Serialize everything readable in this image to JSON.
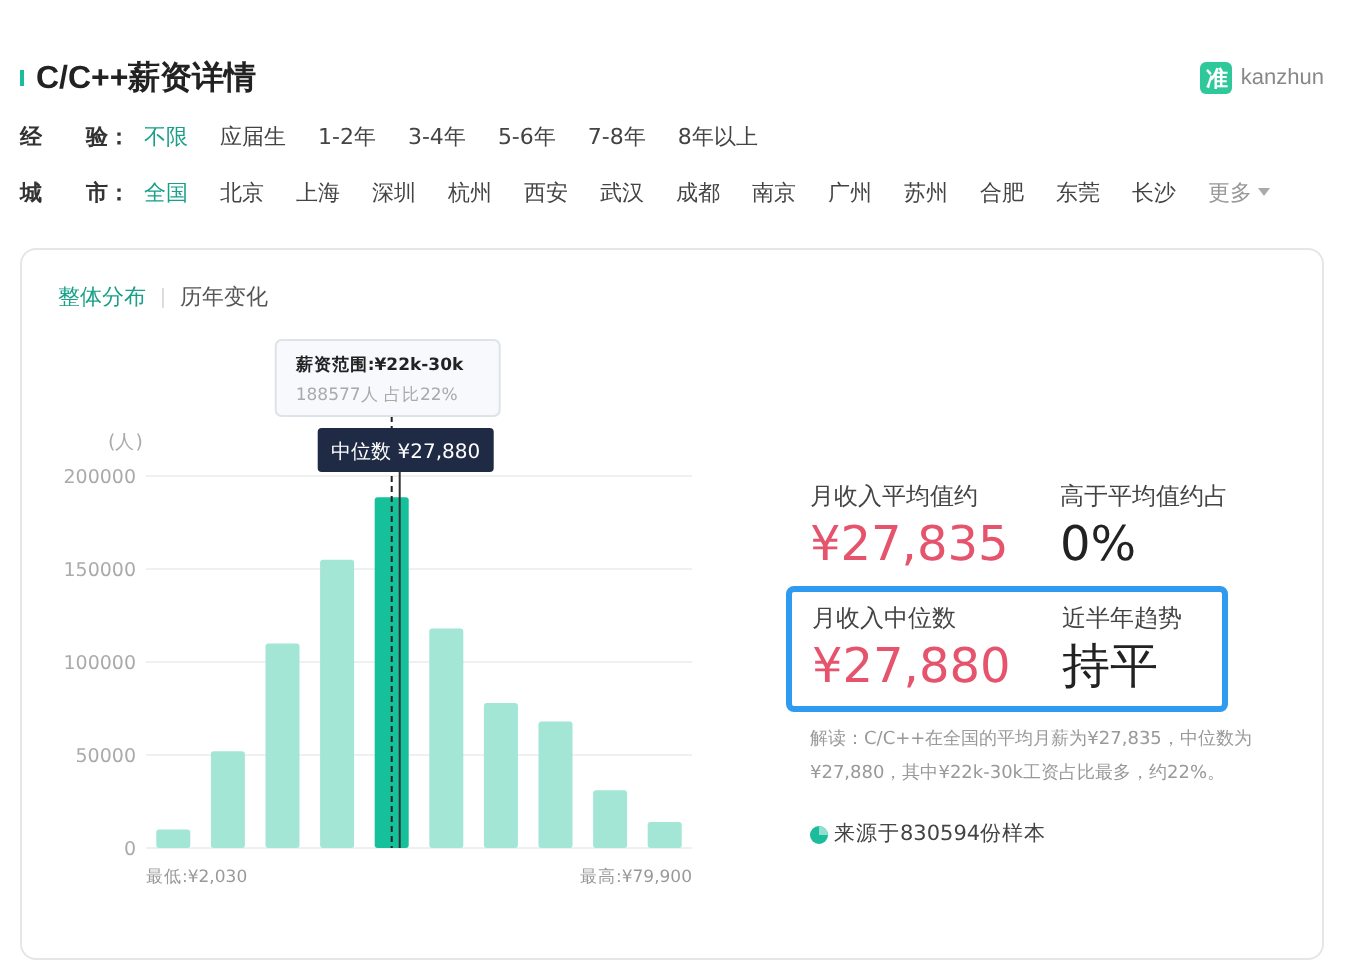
{
  "header": {
    "title": "C/C++薪资详情",
    "logo": {
      "mark": "准",
      "name": "kanzhun"
    }
  },
  "filters": [
    {
      "label": "经　　验：",
      "options": [
        {
          "text": "不限",
          "selected": true
        },
        {
          "text": "应届生",
          "selected": false
        },
        {
          "text": "1-2年",
          "selected": false
        },
        {
          "text": "3-4年",
          "selected": false
        },
        {
          "text": "5-6年",
          "selected": false
        },
        {
          "text": "7-8年",
          "selected": false
        },
        {
          "text": "8年以上",
          "selected": false
        }
      ]
    },
    {
      "label": "城　　市：",
      "options": [
        {
          "text": "全国",
          "selected": true
        },
        {
          "text": "北京",
          "selected": false
        },
        {
          "text": "上海",
          "selected": false
        },
        {
          "text": "深圳",
          "selected": false
        },
        {
          "text": "杭州",
          "selected": false
        },
        {
          "text": "西安",
          "selected": false
        },
        {
          "text": "武汉",
          "selected": false
        },
        {
          "text": "成都",
          "selected": false
        },
        {
          "text": "南京",
          "selected": false
        },
        {
          "text": "广州",
          "selected": false
        },
        {
          "text": "苏州",
          "selected": false
        },
        {
          "text": "合肥",
          "selected": false
        },
        {
          "text": "东莞",
          "selected": false
        },
        {
          "text": "长沙",
          "selected": false
        }
      ],
      "more": "更多"
    }
  ],
  "tabs": [
    {
      "label": "整体分布",
      "selected": true
    },
    {
      "label": "历年变化",
      "selected": false
    }
  ],
  "distribution": {
    "tooltip": {
      "title": "薪资范围:¥22k-30k",
      "detail": "188577人  占比22%"
    },
    "median_label": "中位数 ¥27,880",
    "bars": [
      {
        "selected": false
      },
      {
        "selected": false
      },
      {
        "selected": false
      },
      {
        "selected": false
      },
      {
        "selected": true
      },
      {
        "selected": false
      },
      {
        "selected": false
      },
      {
        "selected": false
      },
      {
        "selected": false
      },
      {
        "selected": false
      }
    ],
    "min_label": "最低:¥2,030",
    "max_label": "最高:¥79,900",
    "chart_data": {
      "type": "bar",
      "ylabel": "(人)",
      "ylim": [
        0,
        200000
      ],
      "yticks": [
        0,
        50000,
        100000,
        150000,
        200000
      ],
      "grid": true,
      "values": [
        10000,
        52000,
        110000,
        155000,
        188577,
        118000,
        78000,
        68000,
        31000,
        14000
      ]
    }
  },
  "stat_groups": [
    {
      "boxed": false,
      "items": [
        {
          "label": "月收入平均值约",
          "value": "¥27,835",
          "kind": "money"
        },
        {
          "label": "高于平均值约占",
          "value": "0%",
          "kind": "plain"
        }
      ]
    },
    {
      "boxed": true,
      "items": [
        {
          "label": "月收入中位数",
          "value": "¥27,880",
          "kind": "money"
        },
        {
          "label": "近半年趋势",
          "value": "持平",
          "kind": "plain"
        }
      ]
    }
  ],
  "note": "解读：C/C++在全国的平均月薪为¥27,835，中位数为¥27,880，其中¥22k-30k工资占比最多，约22%。",
  "source": "来源于830594份样本"
}
